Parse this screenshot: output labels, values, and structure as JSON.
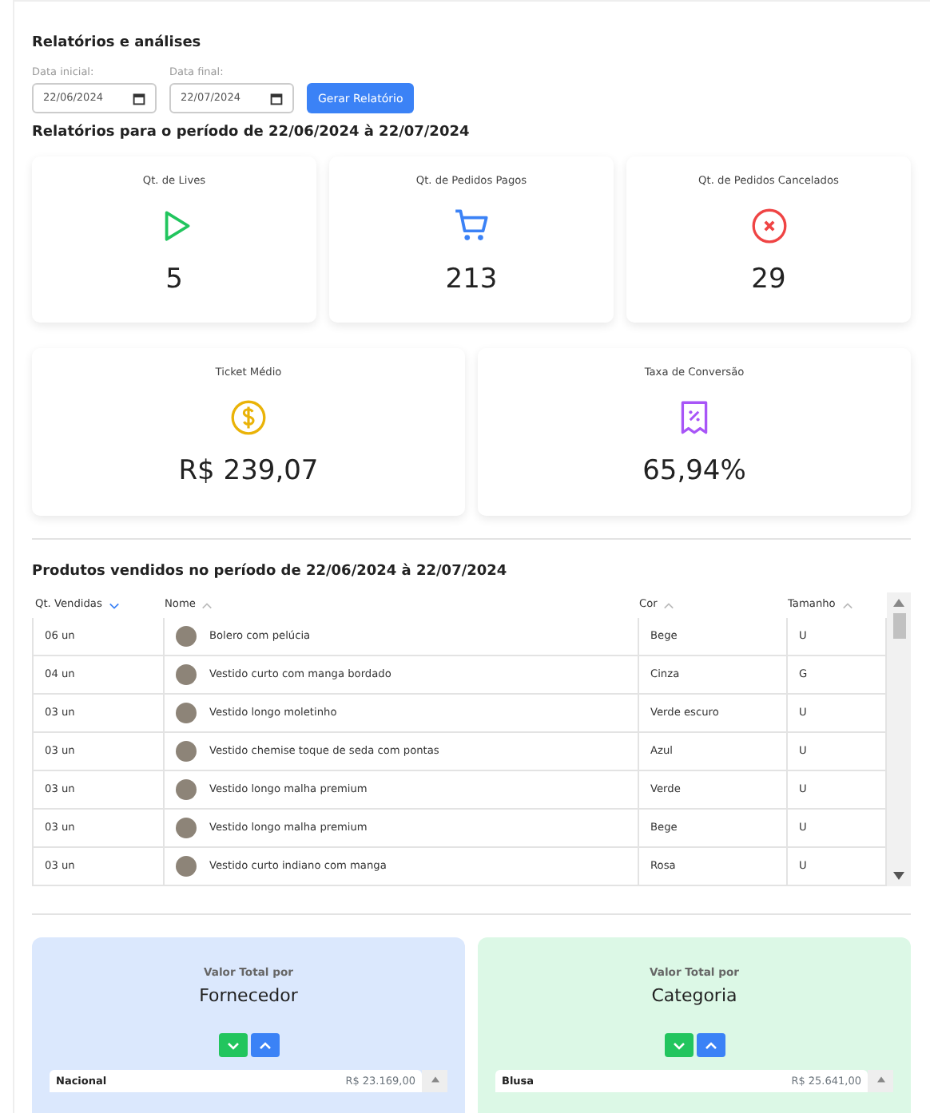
{
  "title": "Relatórios e análises",
  "filters": [
    {
      "label": "Data inicial:",
      "value": "22/06/2024"
    },
    {
      "label": "Data final:",
      "value": "22/07/2024"
    }
  ],
  "generate_button": "Gerar Relatório",
  "period_heading": "Relatórios para o período de 22/06/2024 à 22/07/2024",
  "stats": [
    {
      "kind": "play",
      "color": "#22c55e",
      "label": "Qt. de Lives",
      "value": "5"
    },
    {
      "kind": "cart",
      "color": "#3b82f6",
      "label": "Qt. de Pedidos Pagos",
      "value": "213"
    },
    {
      "kind": "cancel",
      "color": "#ef4444",
      "label": "Qt. de Pedidos Cancelados",
      "value": "29"
    },
    {
      "kind": "dollar",
      "color": "#eab308",
      "label": "Ticket Médio",
      "value": "R$ 239,07"
    },
    {
      "kind": "receipt",
      "color": "#a855f7",
      "label": "Taxa de Conversão",
      "value": "65,94%"
    }
  ],
  "products": {
    "title": "Produtos vendidos no período de 22/06/2024 à 22/07/2024",
    "columns": [
      {
        "label": "Qt. Vendidas",
        "descending": true,
        "active": true
      },
      {
        "label": "Nome",
        "descending": false,
        "active": false
      },
      {
        "label": "Cor",
        "descending": false,
        "active": false
      },
      {
        "label": "Tamanho",
        "descending": false,
        "active": false
      }
    ],
    "rows": [
      {
        "qty": "06 un",
        "name": "Bolero com pelúcia",
        "cor": "Bege",
        "size": "U"
      },
      {
        "qty": "04 un",
        "name": "Vestido curto com manga bordado",
        "cor": "Cinza",
        "size": "G"
      },
      {
        "qty": "03 un",
        "name": "Vestido longo moletinho",
        "cor": "Verde escuro",
        "size": "U"
      },
      {
        "qty": "03 un",
        "name": "Vestido chemise toque de seda com pontas",
        "cor": "Azul",
        "size": "U"
      },
      {
        "qty": "03 un",
        "name": "Vestido longo malha premium",
        "cor": "Verde",
        "size": "U"
      },
      {
        "qty": "03 un",
        "name": "Vestido longo malha premium",
        "cor": "Bege",
        "size": "U"
      },
      {
        "qty": "03 un",
        "name": "Vestido curto indiano com manga",
        "cor": "Rosa",
        "size": "U"
      }
    ]
  },
  "totals": [
    {
      "color": "#dbe8fd",
      "caption": "Valor Total por",
      "title": "Fornecedor",
      "rows": [
        {
          "label": "Nacional",
          "value": "R$ 23.169,00"
        }
      ]
    },
    {
      "color": "#dcf8e6",
      "caption": "Valor Total por",
      "title": "Categoria",
      "rows": [
        {
          "label": "Blusa",
          "value": "R$ 25.641,00"
        }
      ]
    }
  ]
}
